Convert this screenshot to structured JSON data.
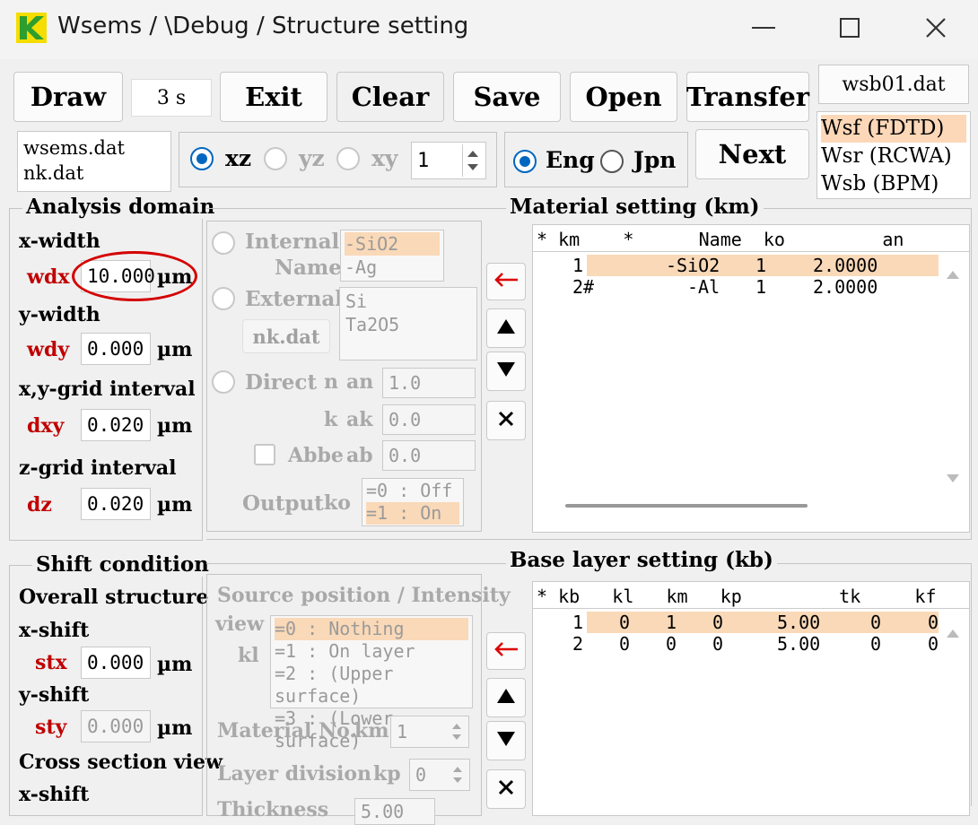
{
  "window": {
    "title": "Wsems / \\Debug / Structure setting"
  },
  "toolbar": {
    "draw": "Draw",
    "time": "3 s",
    "exit": "Exit",
    "clear": "Clear",
    "save": "Save",
    "open": "Open",
    "transfer": "Transfer",
    "file": "wsb01.dat",
    "next": "Next"
  },
  "files": [
    "wsems.dat",
    "nk.dat"
  ],
  "plane": {
    "xz": "xz",
    "yz": "yz",
    "xy": "xy",
    "value": "1",
    "selected": "xz"
  },
  "language": {
    "eng": "Eng",
    "jpn": "Jpn",
    "selected": "Eng"
  },
  "solvers": [
    "Wsf (FDTD)",
    "Wsr (RCWA)",
    "Wsb (BPM)"
  ],
  "analysis_domain": {
    "title": "Analysis domain",
    "x_width": "x-width",
    "wdx_label": "wdx",
    "wdx": "10.000",
    "y_width": "y-width",
    "wdy_label": "wdy",
    "wdy": "0.000",
    "xy_grid": "x,y-grid interval",
    "dxy_label": "dxy",
    "dxy": "0.020",
    "z_grid": "z-grid interval",
    "dz_label": "dz",
    "dz": "0.020",
    "unit": "µm"
  },
  "material_source": {
    "internal": "Internal",
    "name": "Name",
    "internal_items": [
      "-SiO2",
      "-Ag"
    ],
    "external": "External",
    "nkdat": "nk.dat",
    "external_items": [
      "Si",
      "Ta2O5"
    ],
    "direct": "Direct",
    "n": "n",
    "an": "an",
    "an_value": "1.0",
    "k": "k",
    "ak": "ak",
    "ak_value": "0.0",
    "abbe": "Abbe",
    "ab": "ab",
    "ab_value": "0.0",
    "output": "Output",
    "ko": "ko",
    "output_items": [
      "=0 : Off",
      "=1 : On"
    ]
  },
  "material_setting": {
    "title": "Material setting (km)",
    "header": "* km    *      Name  ko         an",
    "rows": [
      {
        "km": "1",
        "name": "-SiO2",
        "ko": "1",
        "an": "2.0000"
      },
      {
        "km": "2#",
        "name": "-Al",
        "ko": "1",
        "an": "2.0000"
      }
    ]
  },
  "shift": {
    "title": "Shift condition",
    "overall": "Overall structure",
    "x_shift": "x-shift",
    "stx_label": "stx",
    "stx": "0.000",
    "y_shift": "y-shift",
    "sty_label": "sty",
    "sty": "0.000",
    "cross": "Cross section view",
    "x_shift2": "x-shift",
    "unit": "µm"
  },
  "source": {
    "title": "Source position / Intensity",
    "view": "view",
    "kl": "kl",
    "items": [
      "=0 : Nothing",
      "=1 : On layer",
      "=2 : (Upper surface)",
      "=3 : (Lower surface)"
    ],
    "material_no": "Material No.",
    "km": "km",
    "km_value": "1",
    "layer_div": "Layer division",
    "kp": "kp",
    "kp_value": "0",
    "thickness": "Thickness",
    "thickness_value": "5.00"
  },
  "base_layer": {
    "title": "Base layer setting (kb)",
    "header": "* kb   kl   km   kp         tk     kf     *",
    "rows": [
      {
        "kb": "1",
        "kl": "0",
        "km": "1",
        "kp": "0",
        "tk": "5.00",
        "kf": "0",
        "x": "0"
      },
      {
        "kb": "2",
        "kl": "0",
        "km": "0",
        "kp": "0",
        "tk": "5.00",
        "kf": "0",
        "x": "0"
      }
    ]
  },
  "colors": {
    "accent": "#0067c0",
    "highlight": "#fad9b8",
    "annotation": "#d40000",
    "label_red": "#c00000"
  }
}
